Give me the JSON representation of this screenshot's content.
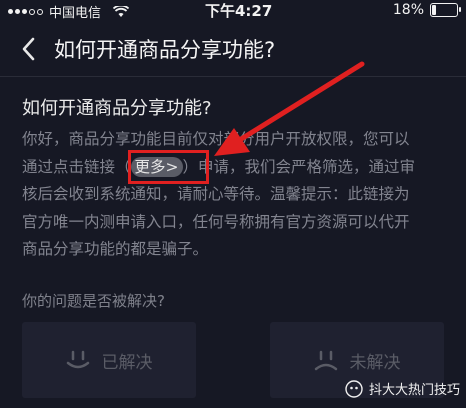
{
  "status_bar": {
    "carrier": "中国电信",
    "time": "下午4:27",
    "battery": "18%"
  },
  "nav": {
    "title": "如何开通商品分享功能?"
  },
  "article": {
    "title": "如何开通商品分享功能?",
    "line1": "你好，商品分享功能目前仅对部分用户开放权限，您可以",
    "line2_before": "通过点击链接",
    "line2_open": "（",
    "more_link": "更多>",
    "line2_close": "）",
    "line2_after": "申请，我们会严格筛选，通过审",
    "line3": "核后会收到系统通知，请耐心等待。温馨提示：此链接为",
    "line4": "官方唯一内测申请入口，任何号称拥有官方资源可以代开",
    "line5": "商品分享功能的都是骗子。"
  },
  "feedback": {
    "question": "你的问题是否被解决?",
    "solved_label": "已解决",
    "unsolved_label": "未解决"
  },
  "watermark": {
    "text": "抖大大热门技巧"
  },
  "colors": {
    "background": "#161824",
    "highlight": "#e02020",
    "body_text": "#82848f"
  }
}
